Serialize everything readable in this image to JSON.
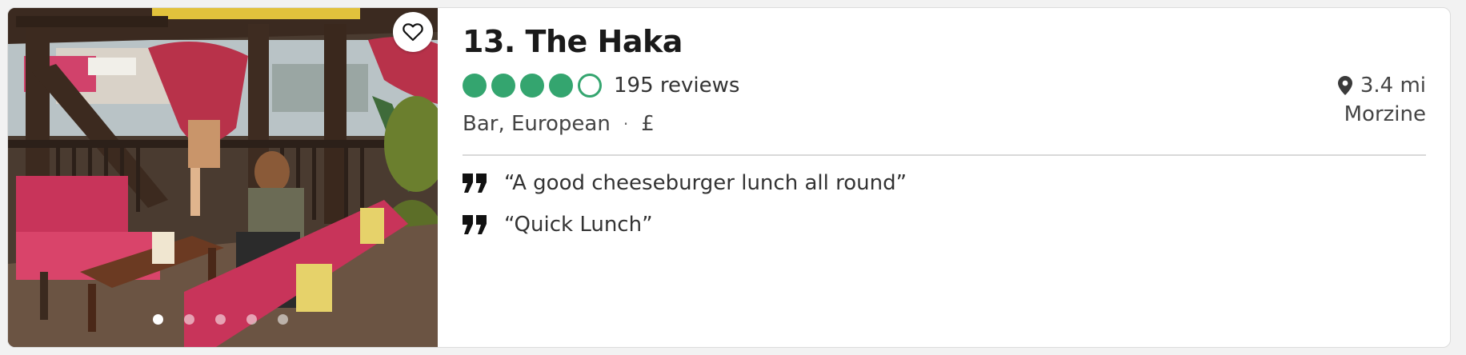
{
  "listing": {
    "title": "13. The Haka",
    "rating": {
      "bubbles_filled": 4,
      "bubbles_total": 5
    },
    "reviews_label": "195 reviews",
    "cuisine": "Bar, European",
    "separator": "·",
    "price": "£",
    "distance": "3.4 mi",
    "location": "Morzine",
    "photo": {
      "dot_count": 5,
      "active_index": 0
    },
    "quotes": [
      {
        "text": "“A good cheeseburger lunch all round”"
      },
      {
        "text": "“Quick Lunch”"
      }
    ]
  },
  "colors": {
    "rating_green": "#34a56f",
    "text_dark": "#1a1a1a"
  },
  "icons": {
    "save": "heart-icon",
    "location": "map-pin-icon",
    "quote": "quote-icon"
  }
}
